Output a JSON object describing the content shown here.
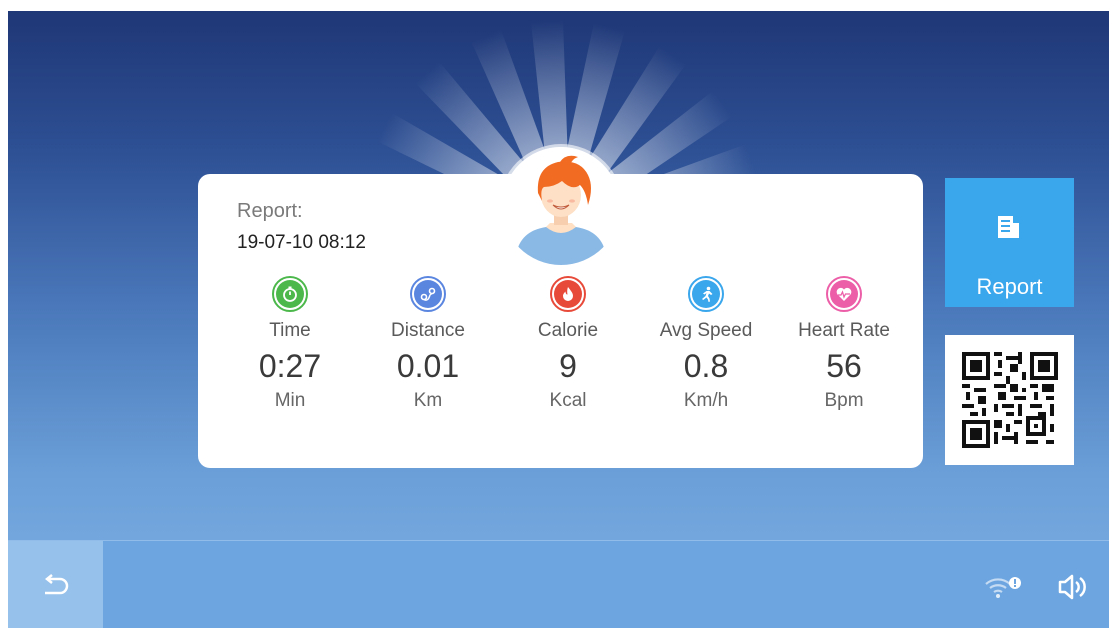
{
  "report": {
    "title": "Report:",
    "datetime": "19-07-10 08:12"
  },
  "stats": [
    {
      "label": "Time",
      "value": "0:27",
      "unit": "Min",
      "icon": "stopwatch-icon",
      "color": "#4cb84c"
    },
    {
      "label": "Distance",
      "value": "0.01",
      "unit": "Km",
      "icon": "route-icon",
      "color": "#5b86e0"
    },
    {
      "label": "Calorie",
      "value": "9",
      "unit": "Kcal",
      "icon": "flame-icon",
      "color": "#e84a3a"
    },
    {
      "label": "Avg Speed",
      "value": "0.8",
      "unit": "Km/h",
      "icon": "runner-icon",
      "color": "#3aa6ec"
    },
    {
      "label": "Heart Rate",
      "value": "56",
      "unit": "Bpm",
      "icon": "heart-icon",
      "color": "#ec5fa8"
    }
  ],
  "side": {
    "report_button_label": "Report",
    "report_icon": "document-icon",
    "qr_icon": "qr-code"
  },
  "bottom_bar": {
    "back_icon": "back-arrow-icon",
    "wifi_icon": "wifi-alert-icon",
    "volume_icon": "speaker-icon"
  },
  "colors": {
    "accent": "#3aa6ec",
    "bottom_bar": "#6ca5e0",
    "back_button": "#96c1ea"
  }
}
